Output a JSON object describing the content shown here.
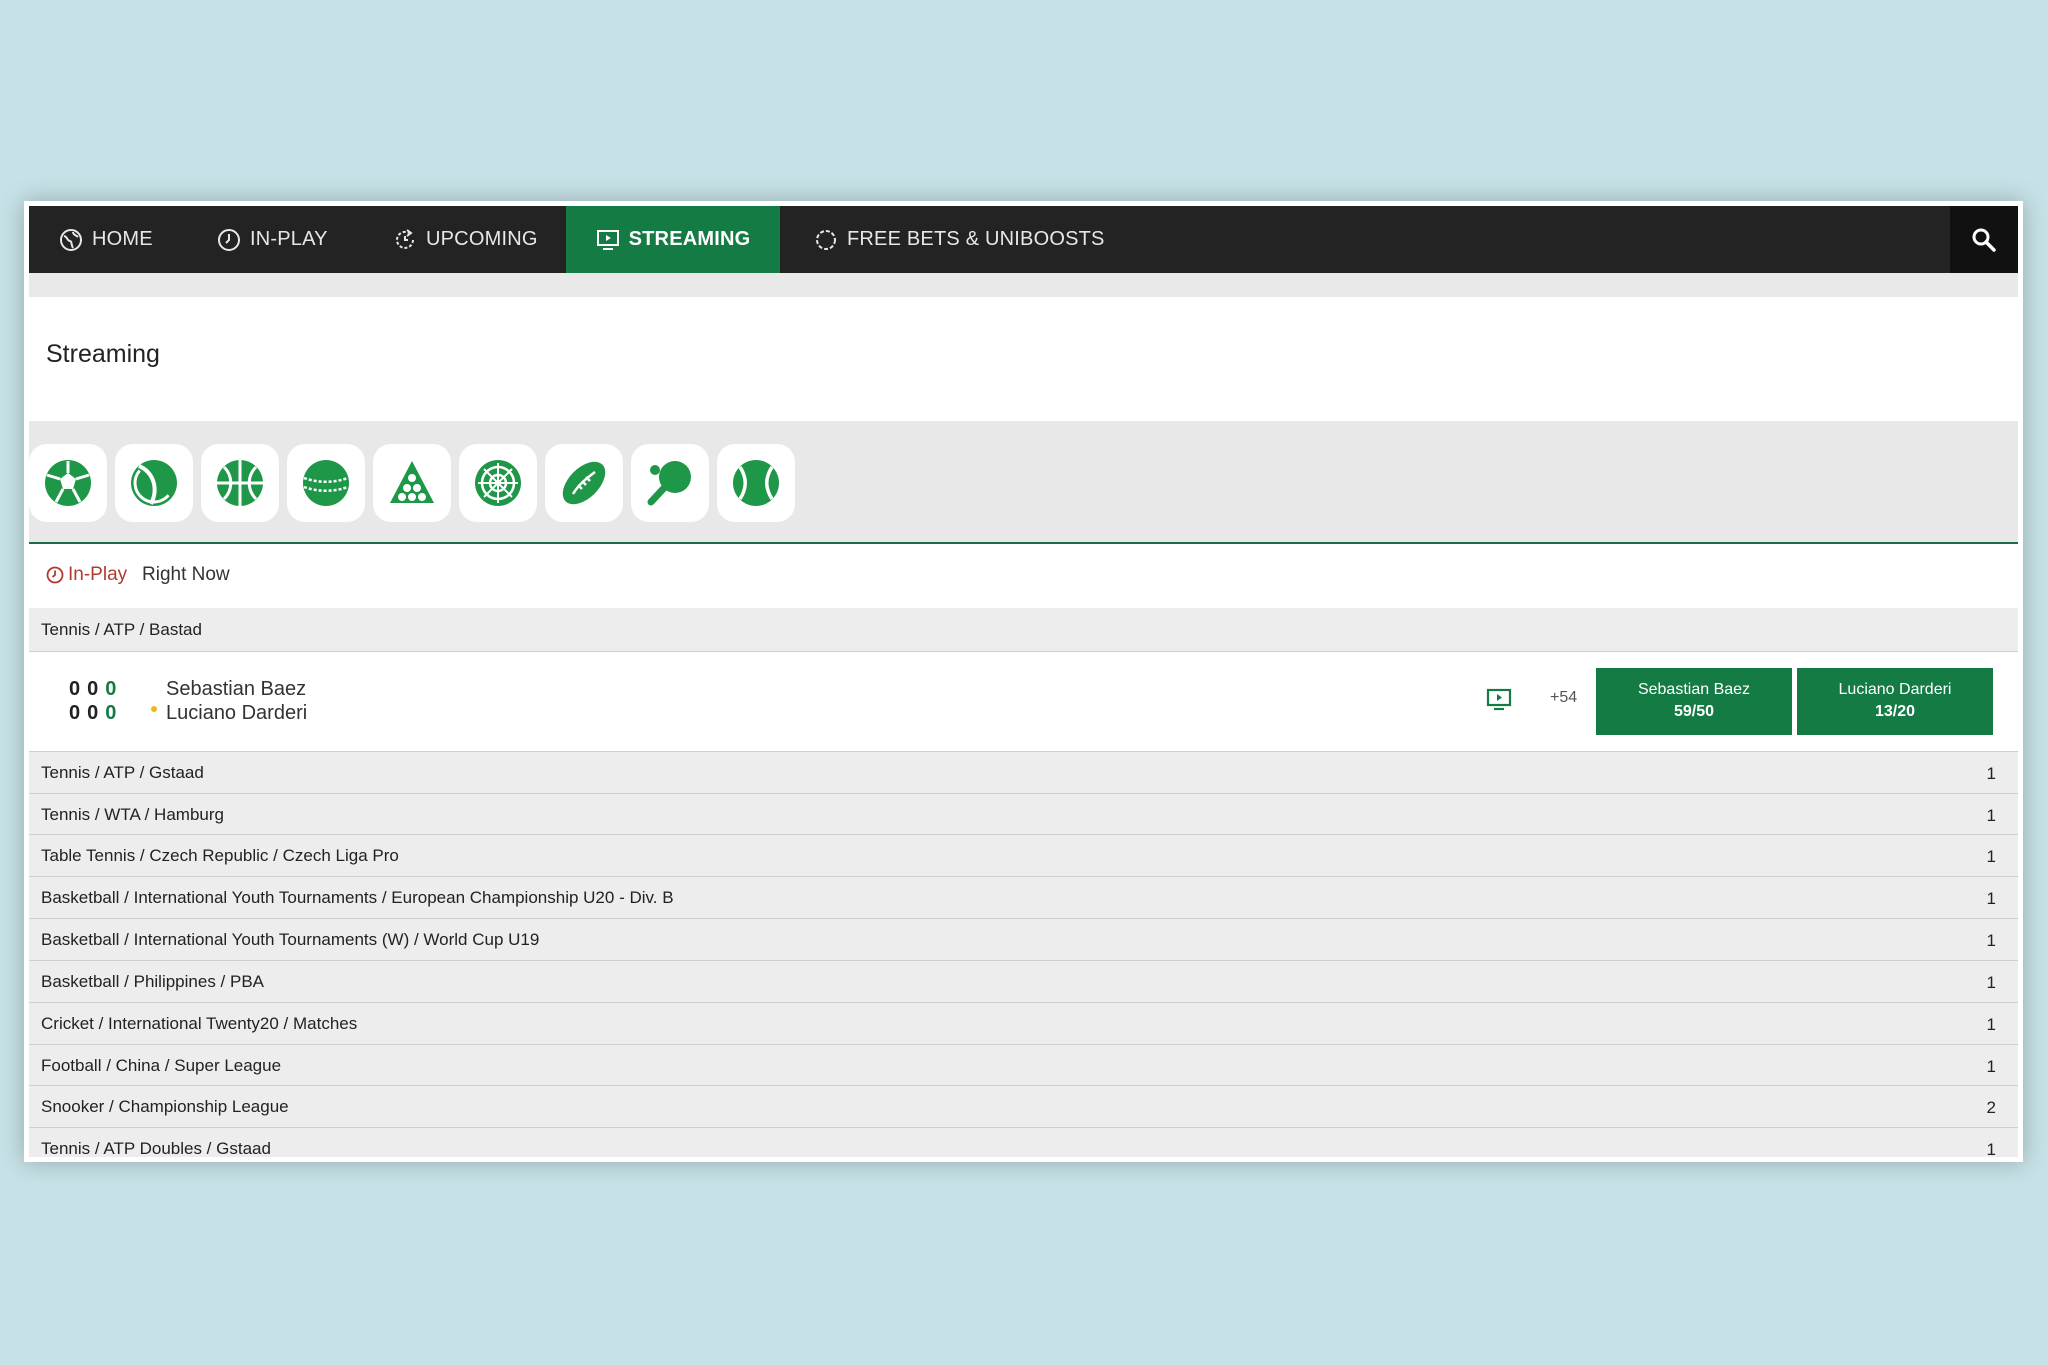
{
  "nav": {
    "items": [
      {
        "label": "HOME",
        "icon": "globe-icon"
      },
      {
        "label": "IN-PLAY",
        "icon": "clock-icon"
      },
      {
        "label": "UPCOMING",
        "icon": "refresh-clock-icon"
      },
      {
        "label": "STREAMING",
        "icon": "tv-play-icon",
        "active": true
      },
      {
        "label": "FREE BETS & UNIBOOSTS",
        "icon": "spinner-icon"
      }
    ],
    "search_icon": "search-icon"
  },
  "page_title": "Streaming",
  "sports": [
    "football-icon",
    "tennis-icon",
    "basketball-icon",
    "cricket-icon",
    "snooker-icon",
    "darts-icon",
    "rugby-icon",
    "table-tennis-icon",
    "tennis-ball-icon"
  ],
  "live": {
    "tag": "In-Play",
    "subtitle": "Right Now"
  },
  "featured_group": {
    "label": "Tennis / ATP / Bastad"
  },
  "match": {
    "player1": {
      "name": "Sebastian Baez",
      "score": [
        "0",
        "0",
        "0"
      ]
    },
    "player2": {
      "name": "Luciano Darderi",
      "score": [
        "0",
        "0",
        "0"
      ]
    },
    "more_markets": "+54",
    "odds": [
      {
        "name": "Sebastian Baez",
        "value": "59/50"
      },
      {
        "name": "Luciano Darderi",
        "value": "13/20"
      }
    ]
  },
  "groups": [
    {
      "label": "Tennis / ATP / Gstaad",
      "count": "1"
    },
    {
      "label": "Tennis / WTA / Hamburg",
      "count": "1"
    },
    {
      "label": "Table Tennis / Czech Republic / Czech Liga Pro",
      "count": "1"
    },
    {
      "label": "Basketball / International Youth Tournaments / European Championship U20 - Div. B",
      "count": "1"
    },
    {
      "label": "Basketball / International Youth Tournaments (W) / World Cup U19",
      "count": "1"
    },
    {
      "label": "Basketball / Philippines / PBA",
      "count": "1"
    },
    {
      "label": "Cricket / International Twenty20 / Matches",
      "count": "1"
    },
    {
      "label": "Football / China / Super League",
      "count": "1"
    },
    {
      "label": "Snooker / Championship League",
      "count": "2"
    },
    {
      "label": "Tennis / ATP Doubles / Gstaad",
      "count": "1"
    }
  ],
  "colors": {
    "brand_green": "#147b45",
    "nav_bg": "#232323",
    "live_red": "#b13a2e",
    "background": "#c6e1e7"
  }
}
